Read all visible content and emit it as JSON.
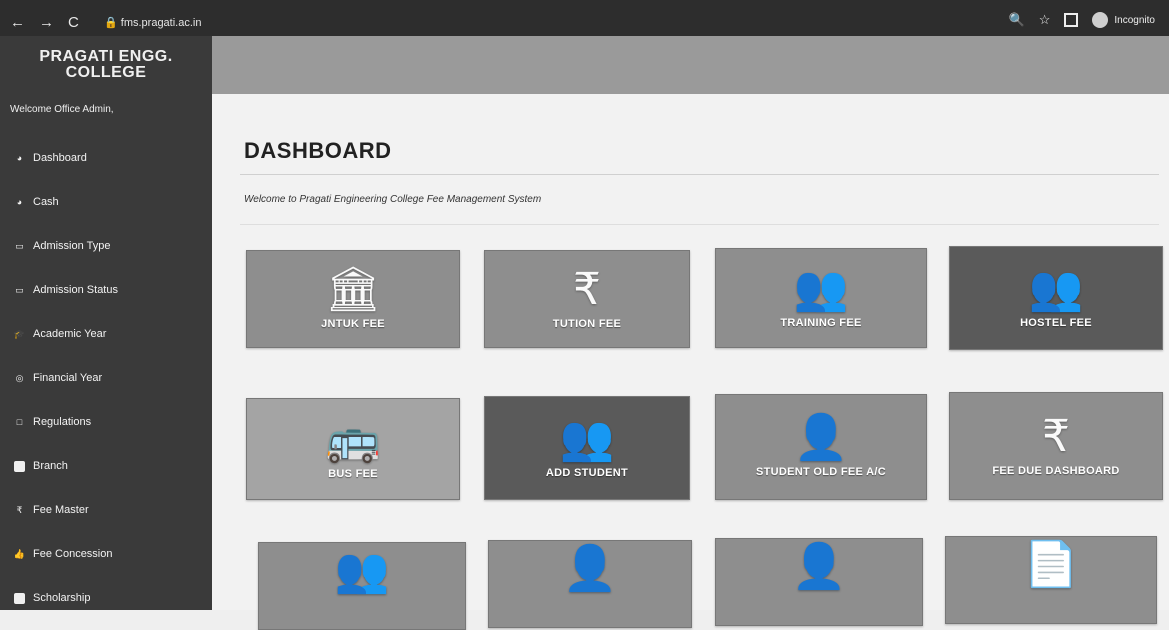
{
  "browser": {
    "url": "fms.pragati.ac.in",
    "incognito_label": "Incognito"
  },
  "sidebar": {
    "brand_line1": "PRAGATI ENGG.",
    "brand_line2": "COLLEGE",
    "welcome": "Welcome Office Admin,",
    "items": [
      {
        "label": "Dashboard",
        "icon": "dashboard-icon"
      },
      {
        "label": "Cash",
        "icon": "cash-icon"
      },
      {
        "label": "Admission Type",
        "icon": "admission-type-icon"
      },
      {
        "label": "Admission Status",
        "icon": "admission-status-icon"
      },
      {
        "label": "Academic Year",
        "icon": "academic-year-icon"
      },
      {
        "label": "Financial Year",
        "icon": "financial-year-icon"
      },
      {
        "label": "Regulations",
        "icon": "regulations-icon"
      },
      {
        "label": "Branch",
        "icon": "branch-icon"
      },
      {
        "label": "Fee Master",
        "icon": "rupee-icon"
      },
      {
        "label": "Fee Concession",
        "icon": "fee-concession-icon"
      },
      {
        "label": "Scholarship",
        "icon": "scholarship-icon"
      }
    ]
  },
  "main": {
    "title": "DASHBOARD",
    "welcome_text": "Welcome to Pragati Engineering College Fee Management System",
    "tiles": [
      {
        "label": "JNTUK FEE",
        "icon": "bank-icon"
      },
      {
        "label": "TUTION FEE",
        "icon": "rupee-icon"
      },
      {
        "label": "TRAINING FEE",
        "icon": "group-icon"
      },
      {
        "label": "HOSTEL FEE",
        "icon": "group-icon"
      },
      {
        "label": "BUS FEE",
        "icon": "bus-icon"
      },
      {
        "label": "ADD STUDENT",
        "icon": "group-icon"
      },
      {
        "label": "STUDENT OLD FEE A/C",
        "icon": "user-icon"
      },
      {
        "label": "FEE DUE DASHBOARD",
        "icon": "rupee-icon"
      },
      {
        "label": "",
        "icon": "group-icon"
      },
      {
        "label": "",
        "icon": "user-icon"
      },
      {
        "label": "",
        "icon": "user-icon"
      },
      {
        "label": "",
        "icon": "document-icon"
      }
    ]
  }
}
